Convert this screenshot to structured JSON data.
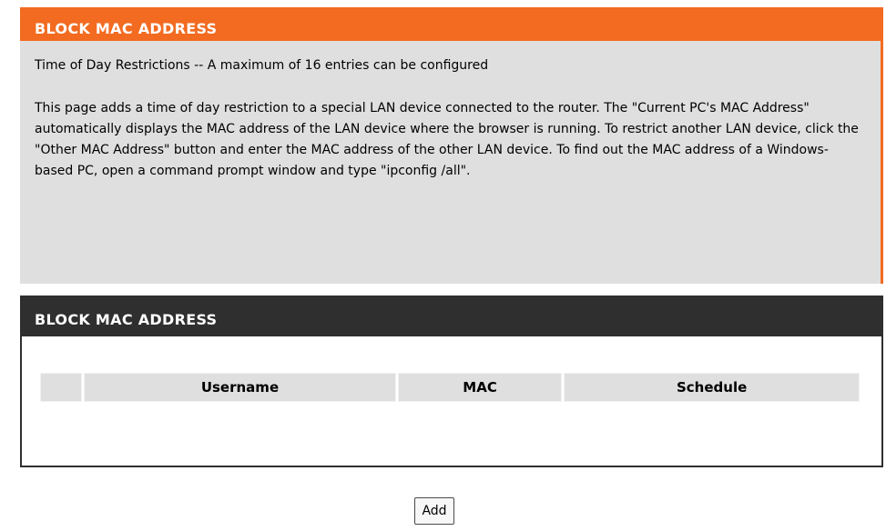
{
  "info_section": {
    "title": "BLOCK MAC ADDRESS",
    "subtitle": "Time of Day Restrictions -- A maximum of 16 entries can be configured",
    "description": "This page adds a time of day restriction to a special LAN device connected to the router. The \"Current PC's MAC Address\" automatically displays the MAC address of the LAN device where the browser is running. To restrict another LAN device, click the \"Other MAC Address\" button and enter the MAC address of the other LAN device. To find out the MAC address of a Windows-based PC, open a command prompt window and type \"ipconfig /all\"."
  },
  "table_section": {
    "title": "BLOCK MAC ADDRESS",
    "columns": [
      "",
      "Username",
      "MAC",
      "Schedule"
    ],
    "rows": []
  },
  "buttons": {
    "add_label": "Add"
  },
  "colors": {
    "accent_orange": "#f26b21",
    "header_dark": "#2f2f2f",
    "panel_gray": "#dfdfdf"
  }
}
